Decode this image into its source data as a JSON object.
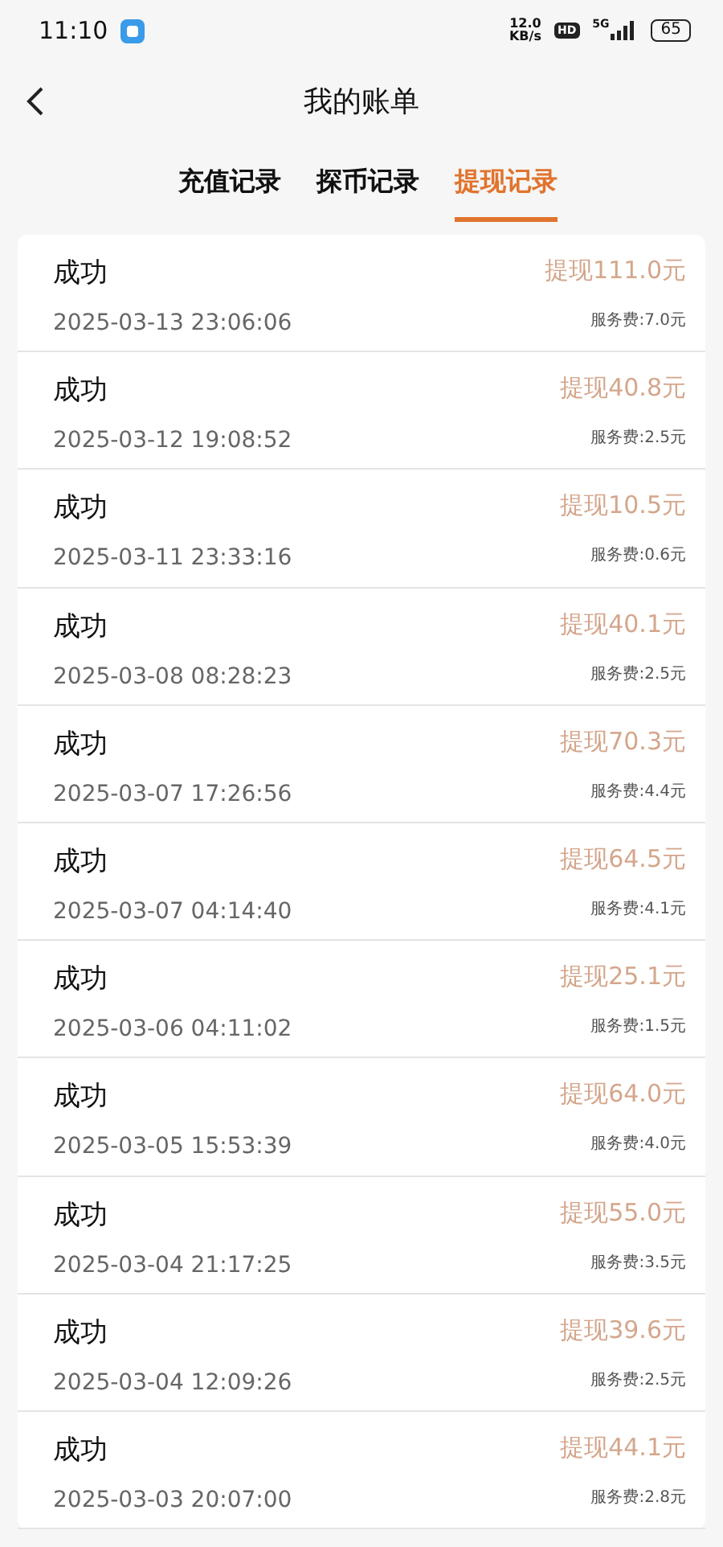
{
  "status_bar": {
    "time": "11:10",
    "speed": "12.0",
    "speed_unit": "KB/s",
    "hd": "HD",
    "network": "5G",
    "battery": "65"
  },
  "nav": {
    "title": "我的账单"
  },
  "tabs": [
    {
      "label": "充值记录",
      "selected": false
    },
    {
      "label": "探币记录",
      "selected": false
    },
    {
      "label": "提现记录",
      "selected": true
    }
  ],
  "records": [
    {
      "status": "成功",
      "time": "2025-03-13 23:06:06",
      "amount": "提现111.0元",
      "fee": "服务费:7.0元"
    },
    {
      "status": "成功",
      "time": "2025-03-12 19:08:52",
      "amount": "提现40.8元",
      "fee": "服务费:2.5元"
    },
    {
      "status": "成功",
      "time": "2025-03-11 23:33:16",
      "amount": "提现10.5元",
      "fee": "服务费:0.6元"
    },
    {
      "status": "成功",
      "time": "2025-03-08 08:28:23",
      "amount": "提现40.1元",
      "fee": "服务费:2.5元"
    },
    {
      "status": "成功",
      "time": "2025-03-07 17:26:56",
      "amount": "提现70.3元",
      "fee": "服务费:4.4元"
    },
    {
      "status": "成功",
      "time": "2025-03-07 04:14:40",
      "amount": "提现64.5元",
      "fee": "服务费:4.1元"
    },
    {
      "status": "成功",
      "time": "2025-03-06 04:11:02",
      "amount": "提现25.1元",
      "fee": "服务费:1.5元"
    },
    {
      "status": "成功",
      "time": "2025-03-05 15:53:39",
      "amount": "提现64.0元",
      "fee": "服务费:4.0元"
    },
    {
      "status": "成功",
      "time": "2025-03-04 21:17:25",
      "amount": "提现55.0元",
      "fee": "服务费:3.5元"
    },
    {
      "status": "成功",
      "time": "2025-03-04 12:09:26",
      "amount": "提现39.6元",
      "fee": "服务费:2.5元"
    },
    {
      "status": "成功",
      "time": "2025-03-03 20:07:00",
      "amount": "提现44.1元",
      "fee": "服务费:2.8元"
    }
  ]
}
